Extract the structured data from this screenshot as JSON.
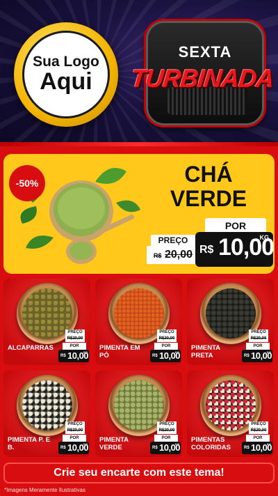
{
  "header": {
    "logo_line1": "Sua Logo",
    "logo_line2": "Aqui",
    "badge_top": "SEXTA",
    "badge_main": "TURBINADA"
  },
  "hero": {
    "discount": "-50%",
    "title_line1": "CHÁ",
    "title_line2": "VERDE",
    "preco_label": "PREÇO",
    "old_currency": "R$",
    "old_value": "20,00",
    "por_label": "POR",
    "new_currency": "R$",
    "new_value": "10,00",
    "unit": "KG"
  },
  "products": [
    {
      "name": "ALCAPARRAS",
      "preco_label": "PREÇO",
      "old": "R$20,00",
      "por_label": "POR",
      "currency": "R$",
      "price": "10,00",
      "unit": "KG"
    },
    {
      "name": "PIMENTA EM PÓ",
      "preco_label": "PREÇO",
      "old": "R$20,00",
      "por_label": "POR",
      "currency": "R$",
      "price": "10,00",
      "unit": "KG"
    },
    {
      "name": "PIMENTA PRETA",
      "preco_label": "PREÇO",
      "old": "R$20,00",
      "por_label": "POR",
      "currency": "R$",
      "price": "10,00",
      "unit": "KG"
    },
    {
      "name": "PIMENTA P. E B.",
      "preco_label": "PREÇO",
      "old": "R$20,00",
      "por_label": "POR",
      "currency": "R$",
      "price": "10,00",
      "unit": "KG"
    },
    {
      "name": "PIMENTA VERDE",
      "preco_label": "PREÇO",
      "old": "R$20,00",
      "por_label": "POR",
      "currency": "R$",
      "price": "10,00",
      "unit": "KG"
    },
    {
      "name": "PIMENTAS COLORIDAS",
      "preco_label": "PREÇO",
      "old": "R$20,00",
      "por_label": "POR",
      "currency": "R$",
      "price": "10,00",
      "unit": "KG"
    }
  ],
  "cta": "Crie seu encarte com este tema!",
  "footnote": "*Imagens Meramente Ilustrativas",
  "colors": {
    "primary_red": "#d80d10",
    "hero_yellow": "#ffc81a",
    "price_black": "#111111",
    "logo_gold": "#f3b400"
  }
}
